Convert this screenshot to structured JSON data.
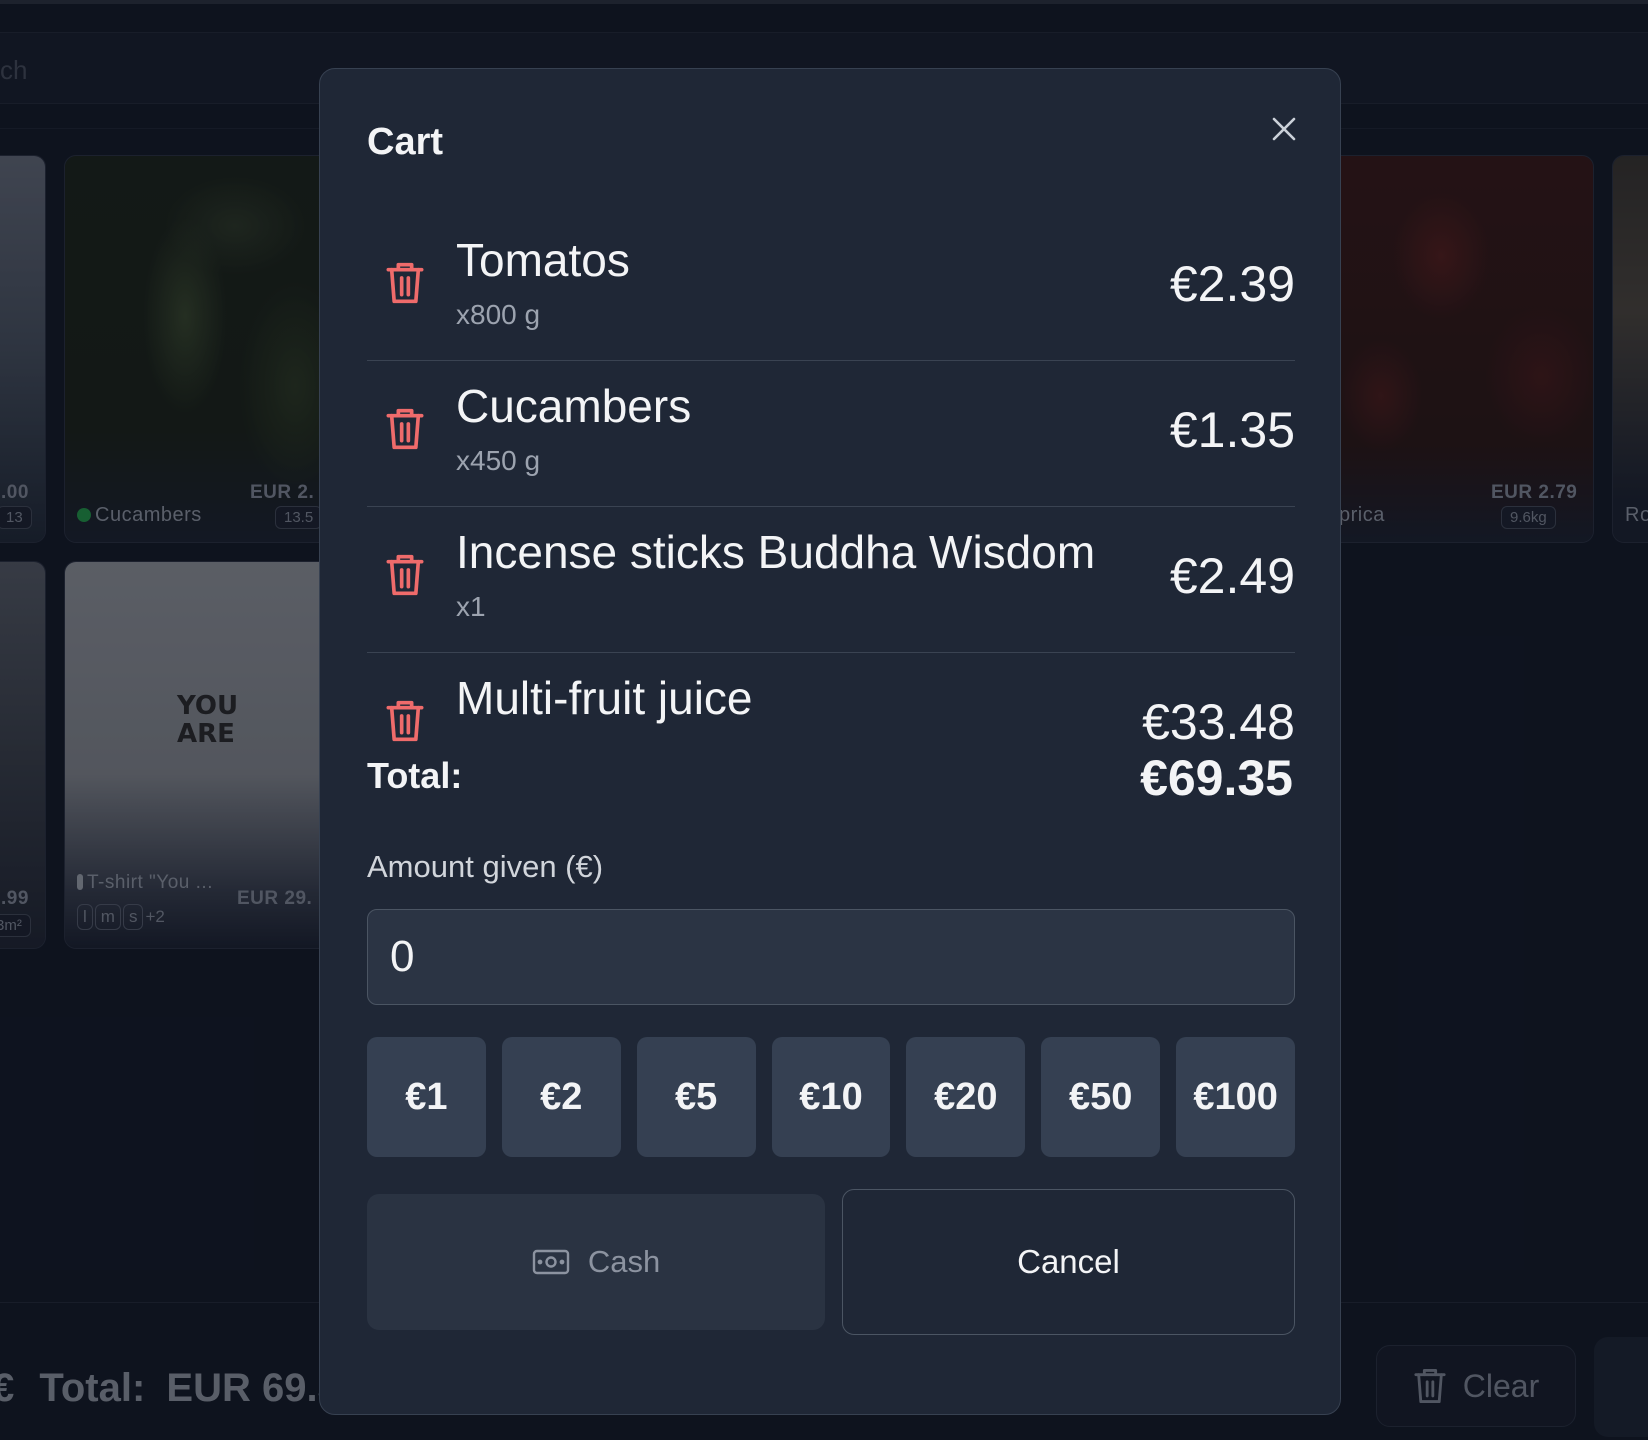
{
  "background": {
    "search_placeholder": "ch",
    "cards": [
      {
        "name": "",
        "price": ".00",
        "badge": "13"
      },
      {
        "name": "Cucambers",
        "price": "EUR 2.",
        "badge": "13.5"
      },
      {
        "name": "prica",
        "price": "EUR 2.79",
        "badge": "9.6kg"
      },
      {
        "name": "Ro",
        "price": "",
        "badge": ""
      },
      {
        "name": "",
        "price": ".99",
        "badge": "3m²"
      },
      {
        "name": "T-shirt \"You ...",
        "price": "EUR 29.",
        "badge": "",
        "sizes": [
          "l",
          "m",
          "s"
        ],
        "more": "+2"
      }
    ],
    "footer": {
      "currency_icon": "€",
      "total_label": "Total:",
      "total_value": "EUR 69.3",
      "clear_label": "Clear"
    },
    "colors": {
      "bg": "#111826",
      "card_bg": "#1a2130"
    }
  },
  "modal": {
    "title": "Cart",
    "items": [
      {
        "name": "Tomatos",
        "qty": "x800 g",
        "price": "€2.39"
      },
      {
        "name": "Cucambers",
        "qty": "x450 g",
        "price": "€1.35"
      },
      {
        "name": "Incense sticks Buddha Wisdom",
        "qty": "x1",
        "price": "€2.49"
      },
      {
        "name": "Multi-fruit juice",
        "qty": "",
        "price": "€33.48"
      }
    ],
    "total_label": "Total:",
    "total_value": "€69.35",
    "amount_label": "Amount given (€)",
    "amount_value": "0",
    "denominations": [
      "€1",
      "€2",
      "€5",
      "€10",
      "€20",
      "€50",
      "€100"
    ],
    "cash_label": "Cash",
    "cancel_label": "Cancel",
    "colors": {
      "modal_bg": "#1f2736",
      "trash": "#ef6b6b",
      "denom_bg": "#354052"
    }
  }
}
